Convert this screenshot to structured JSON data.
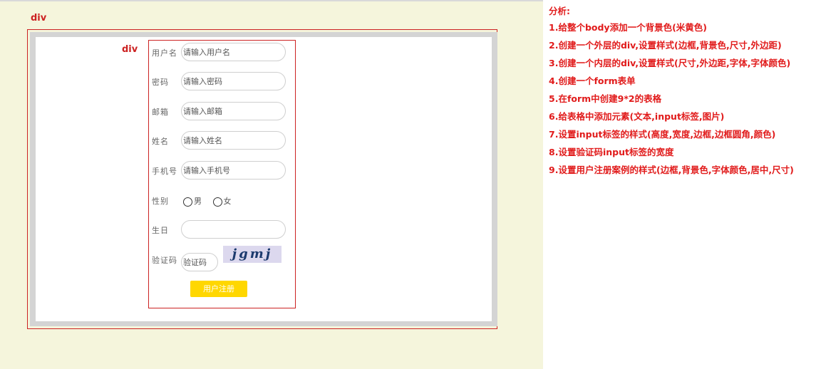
{
  "annotations": {
    "outer_label": "div",
    "inner_label": "div"
  },
  "form": {
    "fields": [
      {
        "label": "用户名",
        "placeholder": "请输入用户名"
      },
      {
        "label": "密码",
        "placeholder": "请输入密码"
      },
      {
        "label": "邮箱",
        "placeholder": "请输入邮箱"
      },
      {
        "label": "姓名",
        "placeholder": "请输入姓名"
      },
      {
        "label": "手机号",
        "placeholder": "请输入手机号"
      }
    ],
    "gender": {
      "label": "性别",
      "options": [
        "男",
        "女"
      ]
    },
    "birthday": {
      "label": "生日",
      "value": ""
    },
    "captcha": {
      "label": "验证码",
      "placeholder": "验证码",
      "image_text": "jgmj"
    },
    "submit_label": "用户注册"
  },
  "analysis": {
    "title": "分析:",
    "items": [
      "1.给整个body添加一个背景色(米黄色)",
      "2.创建一个外层的div,设置样式(边框,背景色,尺寸,外边距)",
      "3.创建一个内层的div,设置样式(尺寸,外边距,字体,字体颜色)",
      "4.创建一个form表单",
      "5.在form中创建9*2的表格",
      "6.给表格中添加元素(文本,input标签,图片)",
      "7.设置input标签的样式(高度,宽度,边框,边框圆角,颜色)",
      "8.设置验证码input标签的宽度",
      "9.设置用户注册案例的样式(边框,背景色,字体颜色,居中,尺寸)"
    ]
  },
  "colors": {
    "page_background": "#f5f5dc",
    "outer_div_background": "#d4d4d4",
    "annotation_red": "#cc2222",
    "submit_button": "#ffd700"
  }
}
